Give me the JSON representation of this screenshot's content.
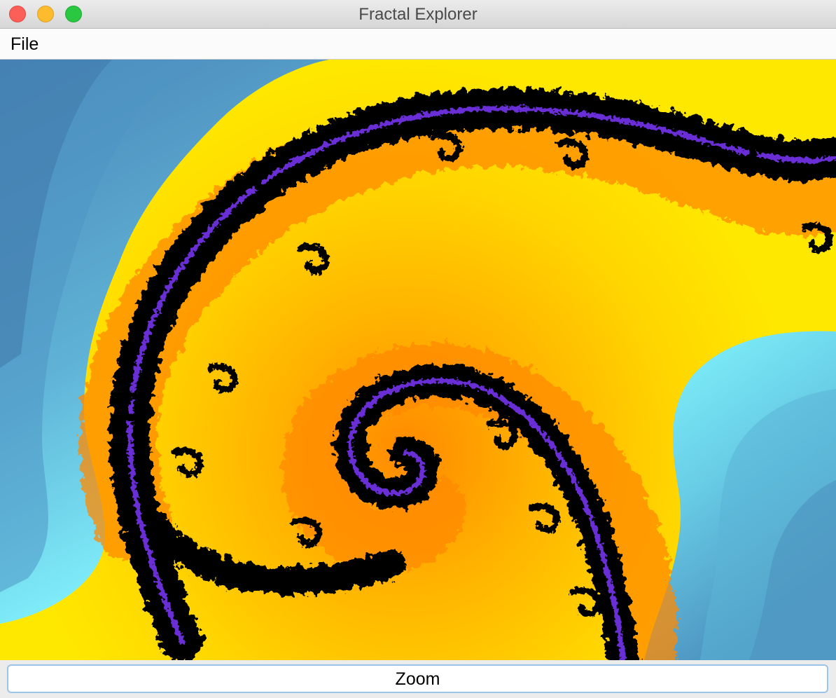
{
  "window": {
    "title": "Fractal Explorer"
  },
  "menu": {
    "items": [
      {
        "label": "File"
      }
    ]
  },
  "canvas": {
    "content": "julia-set-spiral",
    "palette": {
      "interior": "#000000",
      "inner_edge": "#6a2fd6",
      "near": "#ff7a00",
      "mid": "#ffb000",
      "far": "#ffe600",
      "outside_light": "#80f6ff",
      "outside_dark": "#4a86b8"
    }
  },
  "controls": {
    "zoom_label": "Zoom"
  },
  "colors": {
    "close": "#fc5f57",
    "minimize": "#fdbc2e",
    "maximize": "#29c840",
    "button_border": "#9cc3e8"
  }
}
